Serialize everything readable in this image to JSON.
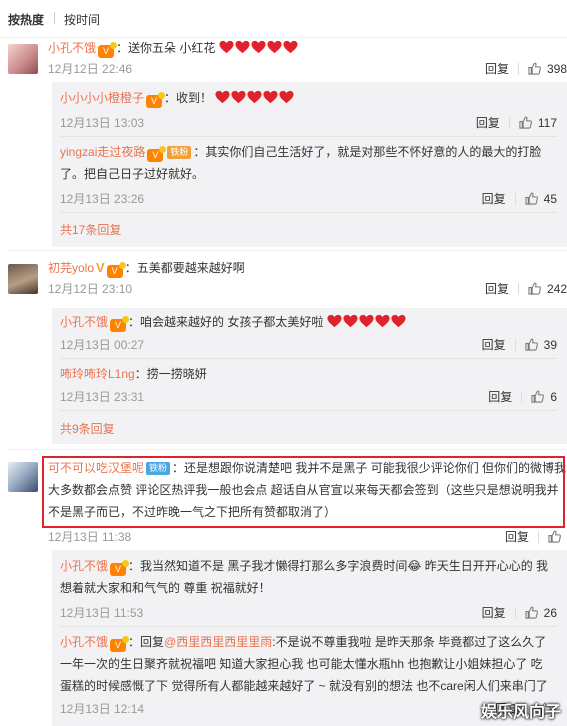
{
  "tabs": {
    "hot": "按热度",
    "time": "按时间"
  },
  "labels": {
    "reply": "回复"
  },
  "colors": {
    "accent": "#eb7350",
    "heart": "#e0232b",
    "highlight": "#e0232b"
  },
  "comments": [
    {
      "user": "小孔不饿",
      "text": "：送你五朵 小红花",
      "hearts": 5,
      "time": "12月12日 22:46",
      "likes": "398",
      "replies": [
        {
          "user": "小小小小橙橙子",
          "text": "：收到！",
          "hearts": 5,
          "time": "12月13日 13:03",
          "likes": "117"
        },
        {
          "user": "yingzai走过夜路",
          "badge": "铁粉",
          "text": "：其实你们自己生活好了，就是对那些不怀好意的人的最大的打脸",
          "text2": "了。把自己日子过好就好。",
          "time": "12月13日 23:26",
          "likes": "45"
        }
      ],
      "more": "共17条回复"
    },
    {
      "user": "初芫yolo",
      "text": "：五美都要越来越好啊",
      "time": "12月12日 23:10",
      "likes": "242",
      "replies": [
        {
          "user": "小孔不饿",
          "text": "：咱会越来越好的 女孩子都太美好啦",
          "hearts": 5,
          "time": "12月13日 00:27",
          "likes": "39"
        },
        {
          "user": "咘玲咘玲L1ng",
          "text": "：捞一捞晓妍",
          "time": "12月13日 23:31",
          "likes": "6"
        }
      ],
      "more": "共9条回复"
    },
    {
      "user": "可不可以吃汉堡呢",
      "badge": "铁粉",
      "text": "：还是想跟你说清楚吧 我并不是黑子 可能我很少评论你们 但你们的微博我",
      "text2": "大多数都会点赞 评论区热评我一般也会点 超话自从官宣以来每天都会签到（这些只是想说明我并",
      "text3": "不是黑子而已，不过昨晚一气之下把所有赞都取消了）",
      "time": "12月13日 11:38",
      "likes": "",
      "replies": [
        {
          "user": "小孔不饿",
          "text": "：我当然知道不是 黑子我才懒得打那么多字浪费时间",
          "emoji": "😂",
          "text_b": "  昨天生日开开心心的 我",
          "text2": "想着就大家和和气气的 尊重 祝福就好！",
          "time": "12月13日 11:53",
          "likes": "26"
        },
        {
          "user": "小孔不饿",
          "text": "：回复",
          "mention": "@西里西里西里里雨",
          "text_b": ":不是说不尊重我啦 是昨天那条 毕竟都过了这么久了",
          "text2": "一年一次的生日聚齐就祝福吧 知道大家担心我 也可能太懂水瓶hh 也抱歉让小姐妹担心了 吃",
          "text3": "蛋糕的时候感慨了下 觉得所有人都能越来越好了 ~ 就没有别的想法 也不care闲人们来串门了",
          "time": "12月13日 12:14",
          "likes": ""
        }
      ]
    }
  ],
  "watermark": "娱乐风向子"
}
